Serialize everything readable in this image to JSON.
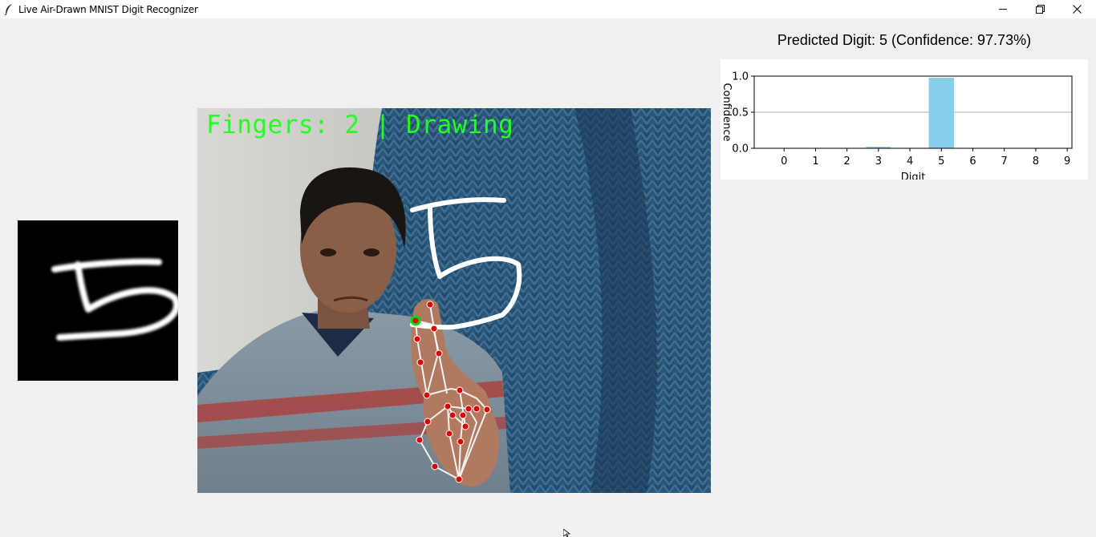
{
  "window": {
    "title": "Live Air-Drawn MNIST Digit Recognizer",
    "controls": [
      "minimize",
      "restore",
      "close"
    ]
  },
  "prediction": {
    "label": "Predicted Digit: 5 (Confidence: 97.73%)"
  },
  "camera_overlay": {
    "status_text": "Fingers: 2 | Drawing"
  },
  "chart_data": {
    "type": "bar",
    "categories": [
      "0",
      "1",
      "2",
      "3",
      "4",
      "5",
      "6",
      "7",
      "8",
      "9"
    ],
    "values": [
      0.0,
      0.0,
      0.0,
      0.02,
      0.0,
      0.977,
      0.0,
      0.0,
      0.0,
      0.0
    ],
    "xlabel": "Digit",
    "ylabel": "Confidence",
    "ylim": [
      0,
      1.0
    ],
    "yticks": [
      "0.0",
      "0.5",
      "1.0"
    ],
    "bar_color": "#87ceeb",
    "grid": "horizontal at 0.5"
  },
  "colors": {
    "overlay_text": "#22ff22",
    "landmark": "#e00000",
    "landmark_active": "#00cc00",
    "stroke": "#ffffff"
  }
}
